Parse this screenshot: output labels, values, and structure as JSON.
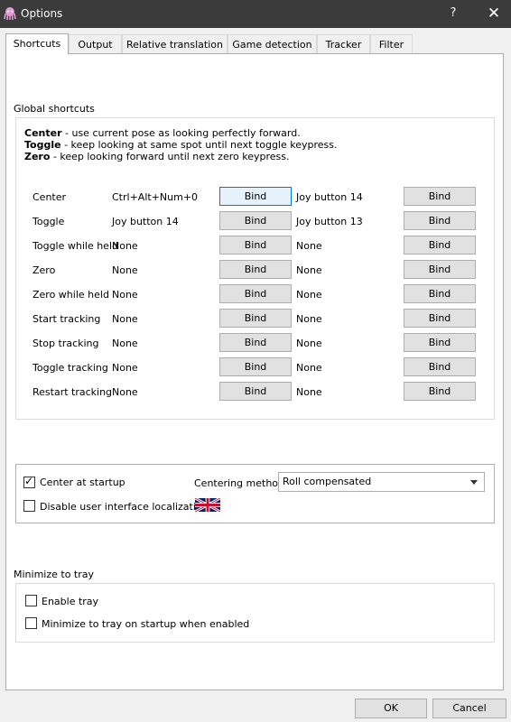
{
  "window": {
    "title": "Options",
    "help": "?",
    "close": "✕"
  },
  "tabs": [
    {
      "label": "Shortcuts"
    },
    {
      "label": "Output"
    },
    {
      "label": "Relative translation"
    },
    {
      "label": "Game detection"
    },
    {
      "label": "Tracker"
    },
    {
      "label": "Filter"
    }
  ],
  "shortcuts": {
    "group_title": "Global shortcuts",
    "desc": [
      {
        "term": "Center",
        "text": " - use current pose as looking perfectly forward."
      },
      {
        "term": "Toggle",
        "text": " - keep looking at same spot until next toggle keypress."
      },
      {
        "term": "Zero",
        "text": " - keep looking forward until next zero keypress."
      }
    ],
    "bind_label": "Bind",
    "rows": [
      {
        "label": "Center",
        "key1": "Ctrl+Alt+Num+0",
        "key2": "Joy button 14"
      },
      {
        "label": "Toggle",
        "key1": "Joy button 14",
        "key2": "Joy button 13"
      },
      {
        "label": "Toggle while held",
        "key1": "None",
        "key2": "None"
      },
      {
        "label": "Zero",
        "key1": "None",
        "key2": "None"
      },
      {
        "label": "Zero while held",
        "key1": "None",
        "key2": "None"
      },
      {
        "label": "Start tracking",
        "key1": "None",
        "key2": "None"
      },
      {
        "label": "Stop tracking",
        "key1": "None",
        "key2": "None"
      },
      {
        "label": "Toggle tracking",
        "key1": "None",
        "key2": "None"
      },
      {
        "label": "Restart tracking",
        "key1": "None",
        "key2": "None"
      }
    ]
  },
  "startup": {
    "center_at_startup": {
      "label": "Center at startup",
      "checked": true
    },
    "disable_localization": {
      "label": "Disable user interface localization",
      "checked": false
    },
    "centering_method_label": "Centering method",
    "centering_method_value": "Roll compensated",
    "flag_icon": "uk-flag-icon"
  },
  "tray": {
    "group_title": "Minimize to tray",
    "enable_tray": {
      "label": "Enable tray",
      "checked": false
    },
    "minimize_on_startup": {
      "label": "Minimize to tray on startup when enabled",
      "checked": false
    }
  },
  "footer": {
    "ok": "OK",
    "cancel": "Cancel"
  }
}
